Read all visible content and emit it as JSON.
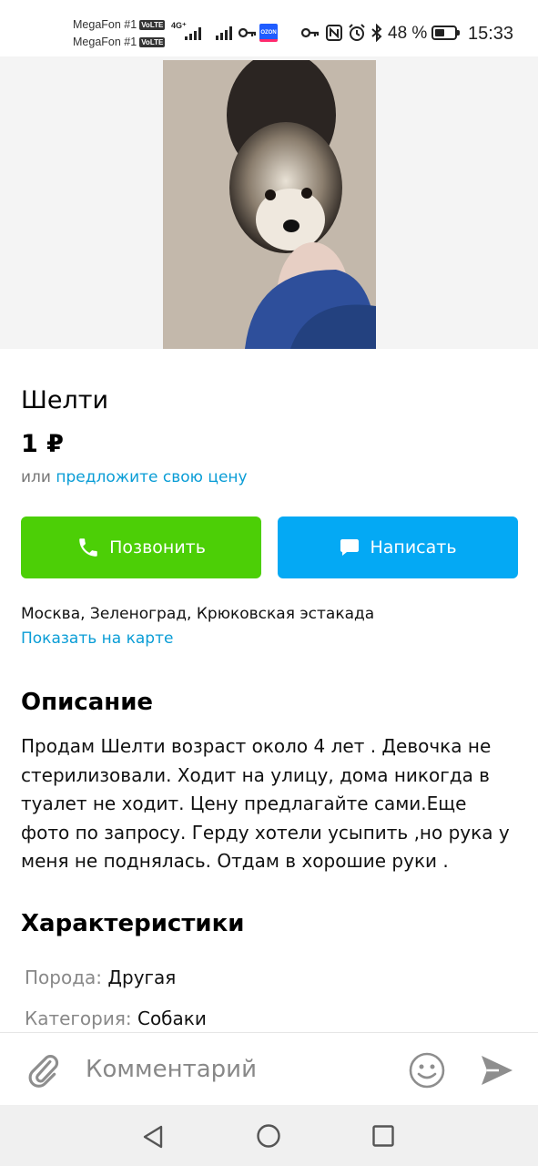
{
  "status_bar": {
    "carrier_1": "MegaFon #1",
    "carrier_2": "MegaFon #1",
    "volte": "VoLTE",
    "network": "4G⁺",
    "ozon": "OZON",
    "battery_text": "48 %",
    "battery_level": 0.48,
    "time": "15:33"
  },
  "listing": {
    "title": "Шелти",
    "price": "1 ₽",
    "offer_prefix": "или",
    "offer_link": "предложите свою цену",
    "call_button": "Позвонить",
    "message_button": "Написать",
    "address": "Москва, Зеленоград, Крюковская эстакада",
    "map_link": "Показать на карте",
    "description_heading": "Описание",
    "description": "Продам Шелти возраст около 4 лет . Девочка не стерилизовали. Ходит на улицу, дома никогда в туалет не ходит. Цену предлагайте сами.Еще фото по запросу. Герду хотели усыпить ,но рука у меня не поднялась. Отдам в хорошие руки .",
    "characteristics_heading": "Характеристики",
    "characteristics": [
      {
        "key": "Порода:",
        "value": "Другая"
      },
      {
        "key": "Категория:",
        "value": "Собаки"
      }
    ]
  },
  "comment_bar": {
    "placeholder": "Комментарий"
  },
  "colors": {
    "call_button": "#4ccf06",
    "message_button": "#04a9f4",
    "link": "#0a9dd6"
  },
  "icons": [
    "phone-icon",
    "chat-bubble-icon",
    "paperclip-icon",
    "smiley-icon",
    "send-icon",
    "nav-back-icon",
    "nav-home-icon",
    "nav-recents-icon"
  ]
}
